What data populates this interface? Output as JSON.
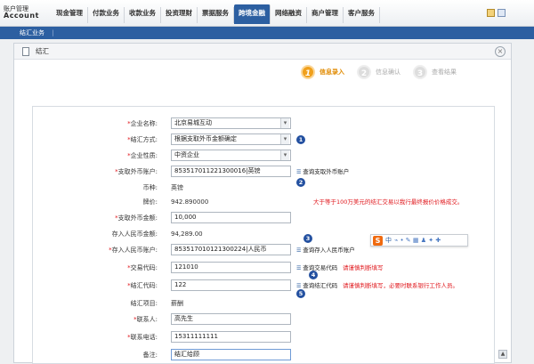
{
  "brand": {
    "cn": "账户管理",
    "en": "Account"
  },
  "nav": {
    "items": [
      {
        "label": "现金管理"
      },
      {
        "label": "付款业务"
      },
      {
        "label": "收款业务"
      },
      {
        "label": "投资理财"
      },
      {
        "label": "票据服务"
      },
      {
        "label": "跨境金融",
        "active": true
      },
      {
        "label": "网络融资"
      },
      {
        "label": "商户管理"
      },
      {
        "label": "客户服务"
      }
    ]
  },
  "subnav": {
    "item": "结汇业务",
    "sep": "|"
  },
  "panel": {
    "title": "结汇",
    "close": "×"
  },
  "steps": [
    {
      "num": "1",
      "label": "信息录入",
      "active": true
    },
    {
      "num": "2",
      "label": "信息确认"
    },
    {
      "num": "3",
      "label": "查看结果"
    }
  ],
  "form": {
    "company_name": {
      "label": "企业名称:",
      "value": "北京易城互动"
    },
    "settle_method": {
      "label": "结汇方式:",
      "value": "根据支取外币金额确定"
    },
    "company_type": {
      "label": "企业性质:",
      "value": "中资企业"
    },
    "fx_account": {
      "label": "支取外币账户:",
      "value": "853517011221300016|英镑",
      "link": "查询支取外币账户"
    },
    "currency": {
      "label": "币种:",
      "value": "英镑"
    },
    "rate": {
      "label": "牌价:",
      "value": "942.890000"
    },
    "warn_rate": "大于等于100万美元的结汇交易以我行最终报价价格成交。",
    "fx_amount": {
      "label": "支取外币金额:",
      "value": "10,000"
    },
    "rmb_amount": {
      "label": "存入人民币金额:",
      "value": "94,289.00"
    },
    "rmb_account": {
      "label": "存入人民币账户:",
      "value": "853517010121300224|人民币",
      "link": "查询存入人民币账户"
    },
    "trade_code": {
      "label": "交易代码:",
      "value": "121010",
      "link": "查询交易代码",
      "warn": "请谨慎判断填写"
    },
    "settle_code": {
      "label": "结汇代码:",
      "value": "122",
      "link": "查询结汇代码",
      "warn": "请谨慎判断填写，必要时联系银行工作人员。"
    },
    "settle_item": {
      "label": "结汇项目:",
      "value": "薪酬"
    },
    "contact": {
      "label": "联系人:",
      "value": "高先生"
    },
    "phone": {
      "label": "联系电话:",
      "value": "15311111111"
    },
    "remark": {
      "label": "备注:",
      "value": "结汇给顾"
    }
  },
  "badges": [
    "1",
    "2",
    "3",
    "4",
    "5"
  ],
  "ime": {
    "s": "S",
    "t": "中",
    "g": "⌁ • ✎ ▦ ♟ ✦ ✚"
  },
  "colors": {
    "brand_blue": "#2c5fa1",
    "required_red": "#e0161b",
    "step_orange": "#f0a01c",
    "badge_blue": "#2350a0"
  }
}
